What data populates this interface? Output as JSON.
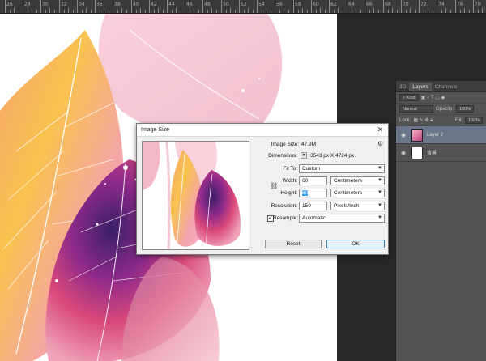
{
  "ruler": {
    "labels": [
      "26",
      "28",
      "30",
      "32",
      "34",
      "36",
      "38",
      "40",
      "42",
      "44",
      "46",
      "48",
      "50",
      "52",
      "54",
      "56",
      "58",
      "60",
      "62",
      "64",
      "66",
      "68",
      "70",
      "72",
      "74",
      "76",
      "78"
    ]
  },
  "panel": {
    "tabs": [
      "3D",
      "Layers",
      "Channels"
    ],
    "kind_label": "Kind",
    "blend_mode": "Normal",
    "opacity_label": "Opacity:",
    "opacity_value": "100%",
    "lock_label": "Lock:",
    "fill_label": "Fill:",
    "fill_value": "100%",
    "layers": [
      {
        "name": "Layer 2",
        "selected": true
      },
      {
        "name": "背景",
        "selected": false
      }
    ]
  },
  "dialog": {
    "title": "Image Size",
    "image_size_label": "Image Size:",
    "image_size_value": "47.9M",
    "dimensions_label": "Dimensions:",
    "dimensions_value": "3543 px  X  4724 px",
    "fit_to_label": "Fit To:",
    "fit_to_value": "Custom",
    "width_label": "Width:",
    "width_value": "60",
    "width_unit": "Centimeters",
    "height_label": "Height:",
    "height_value": "80",
    "height_unit": "Centimeters",
    "resolution_label": "Resolution:",
    "resolution_value": "150",
    "resolution_unit": "Pixels/Inch",
    "resample_label": "Resample:",
    "resample_value": "Automatic",
    "reset_label": "Reset",
    "ok_label": "OK"
  }
}
